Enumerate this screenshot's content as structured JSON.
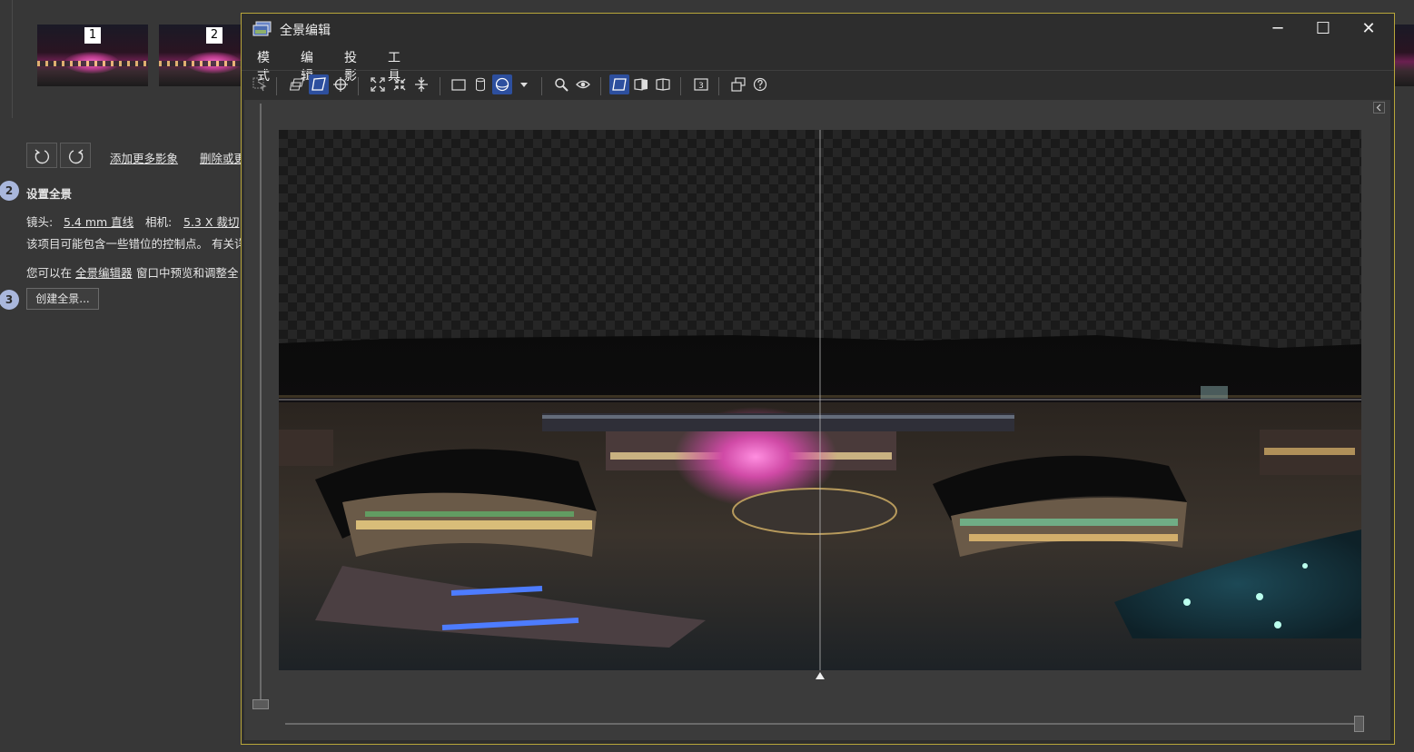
{
  "thumbnails": [
    {
      "number": "1"
    },
    {
      "number": "2"
    }
  ],
  "main": {
    "add_images_link": "添加更多影象",
    "delete_link": "删除或更",
    "step2": {
      "number": "2",
      "title": "设置全景",
      "lens_label": "镜头:",
      "lens_value": "5.4 mm 直线",
      "camera_label": "相机:",
      "camera_value": "5.3 X 裁切",
      "warning_text": "该项目可能包含一些错位的控制点。 有关详",
      "hint_prefix": "您可以在",
      "hint_link": "全景编辑器",
      "hint_suffix": "窗口中预览和调整全"
    },
    "step3": {
      "number": "3",
      "create_button": "创建全景..."
    }
  },
  "editor": {
    "title": "全景编辑",
    "window_controls": {
      "minimize": "─",
      "maximize": "☐",
      "close": "✕"
    },
    "menu": [
      "模式",
      "编辑",
      "投影",
      "工具"
    ],
    "toolbar_icons": [
      "select-icon",
      "move-image-icon",
      "perspective-icon",
      "crosshair-icon",
      "fit-icon",
      "shrink-icon",
      "straighten-icon",
      "rect-projection-icon",
      "cylinder-projection-icon",
      "sphere-projection-icon",
      "dropdown-arrow-icon",
      "zoom-icon",
      "eye-icon",
      "layout-single-icon",
      "layout-split-icon",
      "layout-book-icon",
      "numbered-3-icon",
      "window-icon",
      "help-icon"
    ],
    "toolbar_badge": "3",
    "colors": {
      "accent": "#2d4f9e",
      "border": "#b8a63a"
    }
  }
}
